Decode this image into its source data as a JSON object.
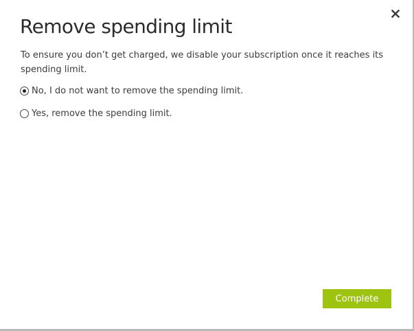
{
  "dialog": {
    "title": "Remove spending limit",
    "description": "To ensure you don’t get charged, we disable your subscription once it reaches its spending limit.",
    "close_icon": "close-icon",
    "options": [
      {
        "label": "No, I do not want to remove the spending limit.",
        "selected": true
      },
      {
        "label": "Yes, remove the spending limit.",
        "selected": false
      }
    ],
    "complete_label": "Complete"
  },
  "colors": {
    "accent": "#9ec411",
    "text": "#333333",
    "border": "#b9b9b9"
  }
}
